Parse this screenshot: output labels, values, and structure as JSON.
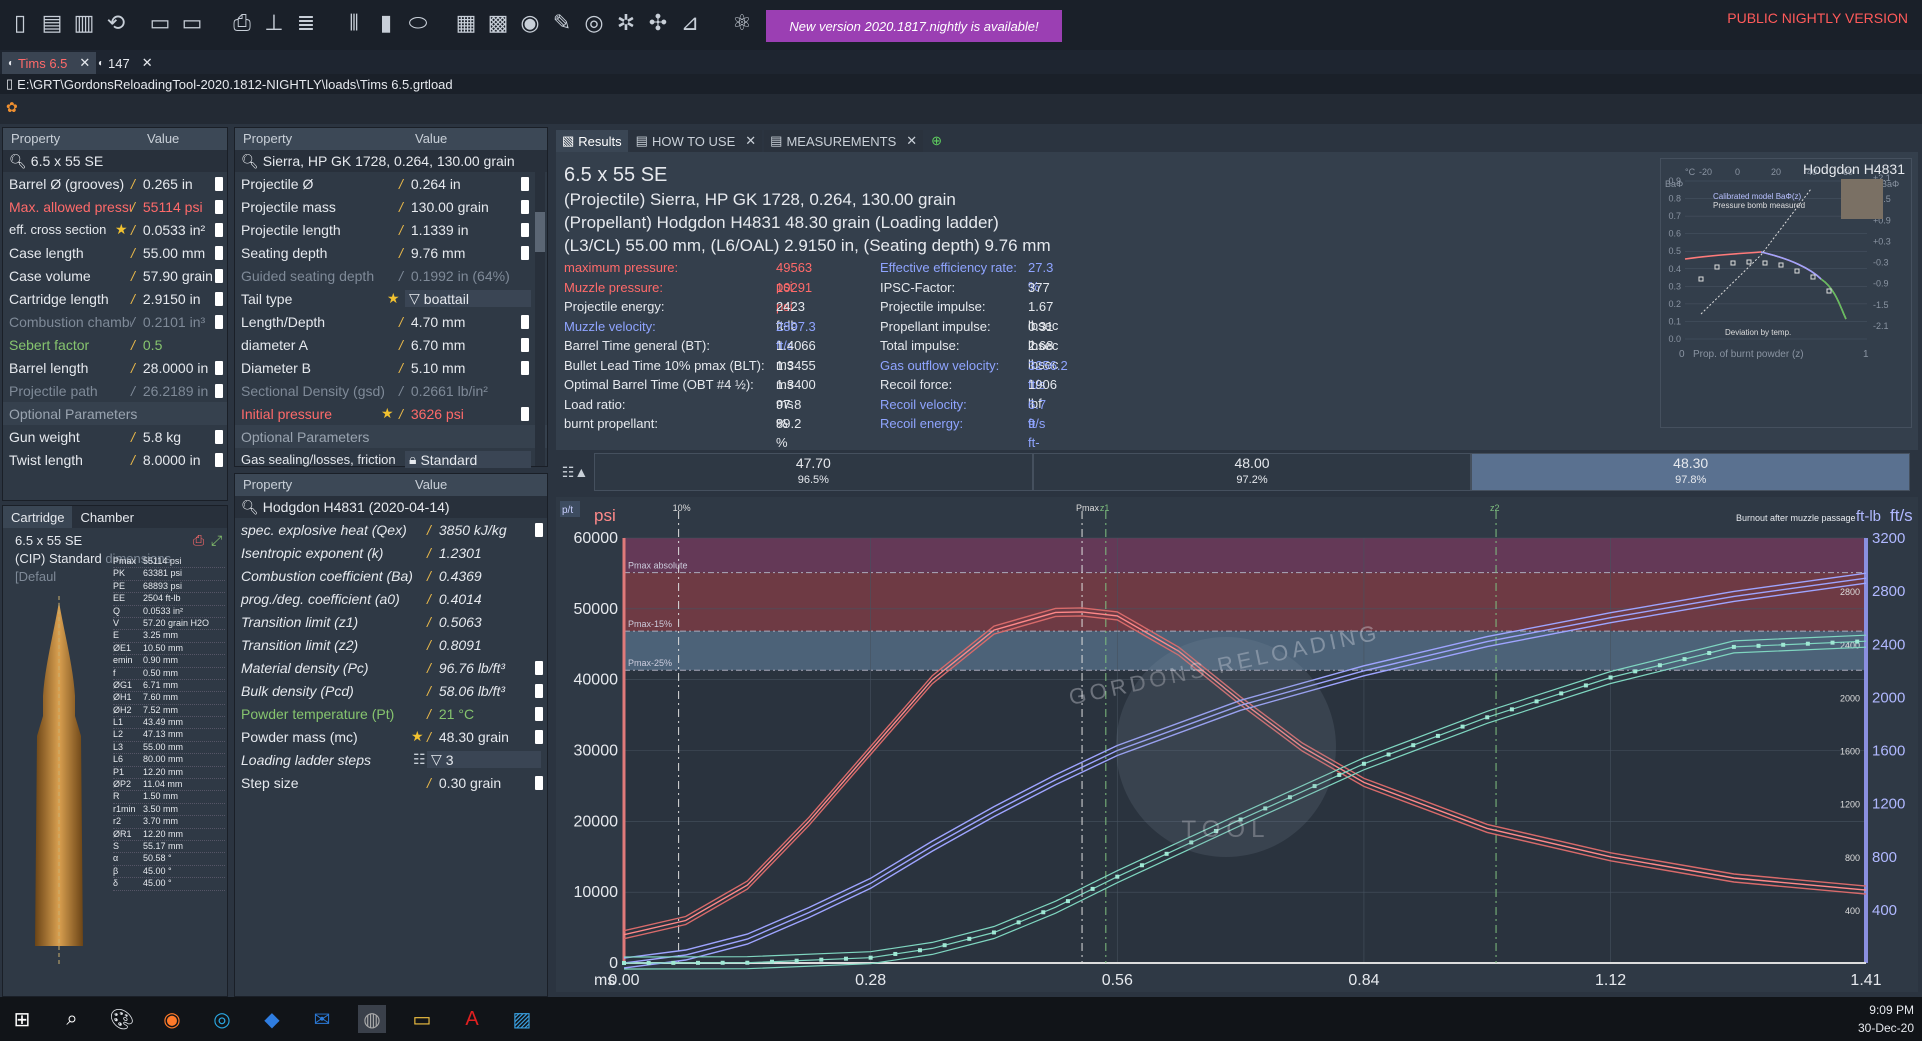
{
  "toolbar": {
    "banner": "New version 2020.1817.nightly is available!",
    "public_version": "PUBLIC NIGHTLY VERSION"
  },
  "file_tabs": [
    {
      "label": "Tims 6.5"
    },
    {
      "label": "147"
    }
  ],
  "path": "E:\\GRT\\GordonsReloadingTool-2020.1812-NIGHTLY\\loads\\Tims 6.5.grtload",
  "headers": {
    "property": "Property",
    "value": "Value"
  },
  "cartridge_panel": {
    "search": "6.5 x 55 SE",
    "rows": [
      {
        "k": "Barrel Ø (grooves)",
        "v": "0.265 in"
      },
      {
        "k": "Max. allowed pressure",
        "v": "55114 psi"
      },
      {
        "k": "eff. cross section",
        "v": "0.0533 in²"
      },
      {
        "k": "Case length",
        "v": "55.00 mm"
      },
      {
        "k": "Case volume",
        "v": "57.90 grain"
      },
      {
        "k": "Cartridge length",
        "v": "2.9150 in"
      },
      {
        "k": "Combustion chamber",
        "v": "0.2101 in³"
      },
      {
        "k": "Sebert factor",
        "v": "0.5"
      },
      {
        "k": "Barrel length",
        "v": "28.0000 in"
      },
      {
        "k": "Projectile path",
        "v": "26.2189 in"
      }
    ],
    "optional": "Optional Parameters",
    "opt_rows": [
      {
        "k": "Gun weight",
        "v": "5.8 kg"
      },
      {
        "k": "Twist length",
        "v": "8.0000 in"
      }
    ]
  },
  "projectile_panel": {
    "search": "Sierra, HP GK 1728, 0.264, 130.00 grain",
    "rows": [
      {
        "k": "Projectile Ø",
        "v": "0.264 in"
      },
      {
        "k": "Projectile mass",
        "v": "130.00 grain"
      },
      {
        "k": "Projectile length",
        "v": "1.1339 in"
      },
      {
        "k": "Seating depth",
        "v": "9.76 mm"
      },
      {
        "k": "Guided seating depth",
        "v": "0.1992 in (64%)"
      },
      {
        "k": "Tail type",
        "v": "boattail"
      },
      {
        "k": "Length/Depth",
        "v": "4.70 mm"
      },
      {
        "k": "diameter A",
        "v": "6.70 mm"
      },
      {
        "k": "Diameter B",
        "v": "5.10 mm"
      },
      {
        "k": "Sectional Density (gsd)",
        "v": "0.2661 lb/in²"
      },
      {
        "k": "Initial pressure",
        "v": "3626 psi"
      }
    ],
    "optional": "Optional Parameters",
    "opt_rows": [
      {
        "k": "Gas sealing/losses, friction",
        "v": "Standard"
      }
    ]
  },
  "powder_panel": {
    "search": "Hodgdon H4831 (2020-04-14)",
    "rows": [
      {
        "k": "spec. explosive heat (Qex)",
        "v": "3850 kJ/kg"
      },
      {
        "k": "Isentropic exponent (k)",
        "v": "1.2301"
      },
      {
        "k": "Combustion coefficient (Ba)",
        "v": "0.4369"
      },
      {
        "k": "prog./deg. coefficient (a0)",
        "v": "0.4014"
      },
      {
        "k": "Transition limit (z1)",
        "v": "0.5063"
      },
      {
        "k": "Transition limit (z2)",
        "v": "0.8091"
      },
      {
        "k": "Material density (Pc)",
        "v": "96.76 lb/ft³"
      },
      {
        "k": "Bulk density (Pcd)",
        "v": "58.06 lb/ft³"
      },
      {
        "k": "Powder temperature (Pt)",
        "v": "21 °C"
      },
      {
        "k": "Powder mass (mc)",
        "v": "48.30 grain"
      },
      {
        "k": "Loading ladder steps",
        "v": "3"
      },
      {
        "k": "Step size",
        "v": "0.30 grain"
      }
    ]
  },
  "bottom_left": {
    "tabs": [
      "Cartridge",
      "Chamber"
    ],
    "name": "6.5 x 55 SE",
    "standard": "(CIP) Standard",
    "standard_extra": "dimensions [Defaul",
    "dims": [
      [
        "Pmax",
        "55114 psi"
      ],
      [
        "PK",
        "63381 psi"
      ],
      [
        "PE",
        "68893 psi"
      ],
      [
        "EE",
        "2504 ft-lb"
      ],
      [
        "Q",
        "0.0533 in²"
      ],
      [
        "V",
        "57.20 grain H2O"
      ],
      [
        "E",
        "3.25 mm"
      ],
      [
        "ØE1",
        "10.50 mm"
      ],
      [
        "emin",
        "0.90 mm"
      ],
      [
        "f",
        "0.50 mm"
      ],
      [
        "ØG1",
        "6.71 mm"
      ],
      [
        "ØH1",
        "7.60 mm"
      ],
      [
        "ØH2",
        "7.52 mm"
      ],
      [
        "L1",
        "43.49 mm"
      ],
      [
        "L2",
        "47.13 mm"
      ],
      [
        "L3",
        "55.00 mm"
      ],
      [
        "L6",
        "80.00 mm"
      ],
      [
        "P1",
        "12.20 mm"
      ],
      [
        "ØP2",
        "11.04 mm"
      ],
      [
        "R",
        "1.50 mm"
      ],
      [
        "r1min",
        "3.50 mm"
      ],
      [
        "r2",
        "3.70 mm"
      ],
      [
        "ØR1",
        "12.20 mm"
      ],
      [
        "S",
        "55.17 mm"
      ],
      [
        "α",
        "50.58 °"
      ],
      [
        "β",
        "45.00 °"
      ],
      [
        "δ",
        "45.00 °"
      ]
    ]
  },
  "results_tabs": [
    "Results",
    "HOW TO USE",
    "MEASUREMENTS"
  ],
  "summary": [
    "6.5 x 55 SE",
    "(Projectile) Sierra, HP GK 1728, 0.264, 130.00 grain",
    "(Propellant) Hodgdon H4831 48.30 grain (Loading ladder)",
    "(L3/CL) 55.00 mm, (L6/OAL) 2.9150 in, (Seating depth) 9.76 mm"
  ],
  "results_left": [
    {
      "k": "maximum pressure:",
      "v": "49563 psi",
      "c": "red"
    },
    {
      "k": "Muzzle pressure:",
      "v": "10291 psi",
      "c": "red"
    },
    {
      "k": "Projectile energy:",
      "v": "2423 ft-lb",
      "c": "w"
    },
    {
      "k": "Muzzle velocity:",
      "v": "2897.3 ft/s",
      "c": "blue"
    },
    {
      "k": "Barrel Time general (BT):",
      "v": "1.4066 ms",
      "c": "w"
    },
    {
      "k": "Bullet Lead Time 10% pmax (BLT):",
      "v": "1.3455 ms",
      "c": "w"
    },
    {
      "k": "Optimal Barrel Time (OBT #4 ½):",
      "v": "1.3400 ms",
      "c": "w"
    },
    {
      "k": "Load ratio:",
      "v": "97.8 %",
      "c": "w"
    },
    {
      "k": "burnt propellant:",
      "v": "89.2 %",
      "c": "w"
    }
  ],
  "results_right": [
    {
      "k": "Effective efficiency rate:",
      "v": "27.3 %",
      "c": "blue"
    },
    {
      "k": "IPSC-Factor:",
      "v": "377",
      "c": "w"
    },
    {
      "k": "Projectile impulse:",
      "v": "1.67 lbsec",
      "c": "w"
    },
    {
      "k": "Propellant impulse:",
      "v": "0.31 lbsec",
      "c": "w"
    },
    {
      "k": "Total impulse:",
      "v": "2.68 lbsec",
      "c": "w"
    },
    {
      "k": "Gas outflow velocity:",
      "v": "3256.2 ft/s",
      "c": "blue"
    },
    {
      "k": "Recoil force:",
      "v": "1906 lbf",
      "c": "w"
    },
    {
      "k": "Recoil velocity:",
      "v": "6.7 ft/s",
      "c": "blue"
    },
    {
      "k": "Recoil energy:",
      "v": "9 ft-lb",
      "c": "blue"
    }
  ],
  "mini_chart": {
    "title": "Hodgdon H4831",
    "xlabel": "Prop. of burnt powder (z)",
    "ylabel_left": "BaΦ",
    "ylabel_right": "BaΦ",
    "legend": [
      "Calibrated model BaΦ(z)",
      "Pressure bomb measured"
    ],
    "note": "Deviation by temp.",
    "top_axis": [
      "-20",
      "0",
      "20",
      "40",
      "60"
    ],
    "left_ticks": [
      "0.0",
      "0.1",
      "0.2",
      "0.3",
      "0.4",
      "0.5",
      "0.6",
      "0.7",
      "0.8",
      "0.9"
    ],
    "right_ticks": [
      "-2.1",
      "-1.5",
      "-0.9",
      "-0.3",
      "+0.3",
      "+0.9",
      "+1.5",
      "+2.1"
    ],
    "x_ticks": [
      "0",
      "1"
    ],
    "top_unit": "°C"
  },
  "ladder": [
    {
      "mass": "47.70",
      "ratio": "96.5%"
    },
    {
      "mass": "48.00",
      "ratio": "97.2%"
    },
    {
      "mass": "48.30",
      "ratio": "97.8%"
    }
  ],
  "chart_data": {
    "type": "line",
    "xlabel": "ms",
    "ylabel": "psi",
    "ylabel_right": "ft/s",
    "ylabel_right2": "ft-lb",
    "xlim": [
      0,
      1.41
    ],
    "ylim": [
      0,
      60000
    ],
    "ylim_right": [
      0,
      3200
    ],
    "x_ticks": [
      "0.00",
      "0.28",
      "0.56",
      "0.84",
      "1.12",
      "1.41"
    ],
    "y_ticks": [
      "0",
      "10000",
      "20000",
      "30000",
      "40000",
      "50000",
      "60000"
    ],
    "y_right_ticks": [
      "400",
      "800",
      "1200",
      "1600",
      "2000",
      "2400",
      "2800",
      "3200"
    ],
    "y_right2_ticks": [
      "400",
      "800",
      "1200",
      "1600",
      "2000",
      "2400",
      "2800"
    ],
    "bands": [
      "Pmax absolute",
      "Pmax-15%",
      "Pmax-25%"
    ],
    "markers": [
      "10%",
      "Pmax",
      "z1",
      "z2"
    ],
    "annotation": "Burnout after muzzle passage",
    "toggle": "p/t",
    "series": [
      {
        "name": "pressure",
        "x": [
          0,
          0.07,
          0.14,
          0.21,
          0.28,
          0.35,
          0.42,
          0.49,
          0.52,
          0.56,
          0.63,
          0.7,
          0.77,
          0.84,
          0.98,
          1.12,
          1.26,
          1.41
        ],
        "values": [
          4000,
          6000,
          11000,
          20000,
          30000,
          40000,
          47000,
          49500,
          49563,
          49000,
          44000,
          37000,
          30500,
          25500,
          19000,
          15000,
          12000,
          10291
        ]
      },
      {
        "name": "velocity",
        "x": [
          0,
          0.07,
          0.14,
          0.21,
          0.28,
          0.35,
          0.42,
          0.49,
          0.56,
          0.7,
          0.84,
          0.98,
          1.12,
          1.26,
          1.41
        ],
        "values": [
          0,
          60,
          180,
          380,
          600,
          880,
          1140,
          1380,
          1600,
          1940,
          2200,
          2420,
          2600,
          2760,
          2897
        ]
      },
      {
        "name": "energy",
        "x": [
          0,
          0.14,
          0.28,
          0.35,
          0.42,
          0.49,
          0.56,
          0.7,
          0.84,
          0.98,
          1.12,
          1.26,
          1.41
        ],
        "values": [
          0,
          2,
          40,
          110,
          230,
          420,
          650,
          1080,
          1500,
          1850,
          2150,
          2380,
          2423
        ]
      }
    ]
  },
  "watermark": {
    "top": "GORDONS RELOADING",
    "bottom": "TOOL"
  },
  "taskbar": {
    "time": "9:09 PM",
    "date": "30-Dec-20"
  }
}
